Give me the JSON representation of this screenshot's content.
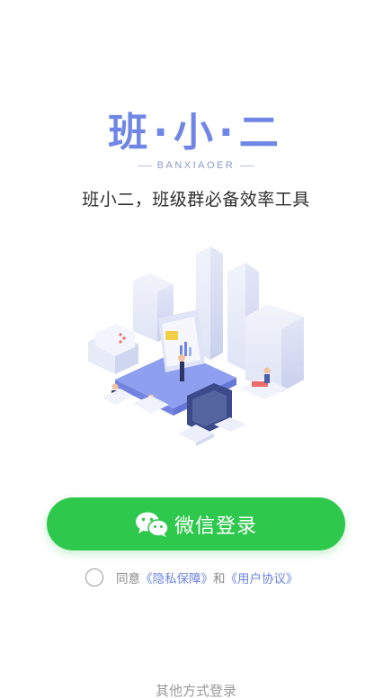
{
  "brand": {
    "logo_text": "班·小·二",
    "logo_sub": "BANXIAOER",
    "slogan": "班小二，班级群必备效率工具"
  },
  "login": {
    "wechat_label": "微信登录",
    "agree_prefix": "同意",
    "privacy_link": "《隐私保障》",
    "agree_and": "和",
    "terms_link": "《用户协议》",
    "other_login": "其他方式登录"
  },
  "colors": {
    "brand_blue": "#6f86e6",
    "wechat_green": "#2ec84d",
    "link_blue": "#6d84e0"
  },
  "icons": {
    "wechat": "wechat-icon",
    "radio": "radio-unchecked-icon"
  }
}
